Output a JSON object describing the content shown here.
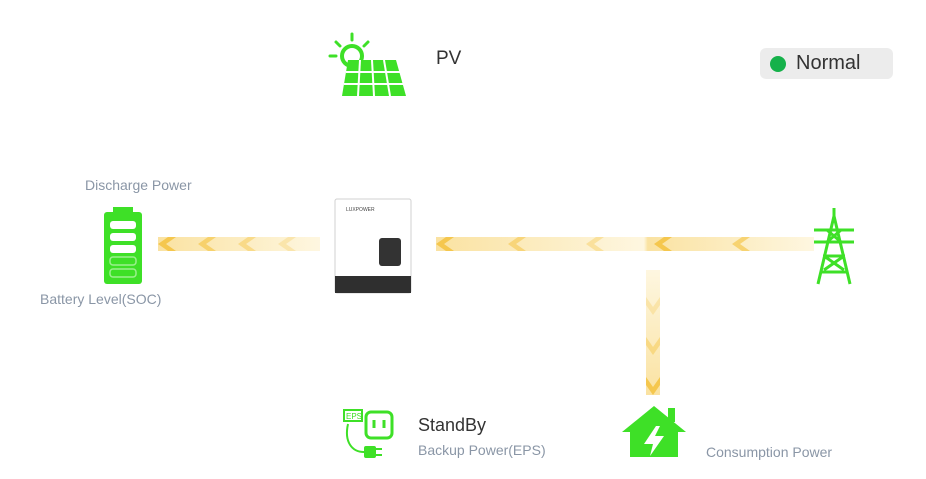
{
  "status": {
    "label": "Normal",
    "color": "#15b14a"
  },
  "pv": {
    "label": "PV",
    "icon": "solar-panel-icon"
  },
  "battery": {
    "discharge_label": "Discharge Power",
    "soc_label": "Battery Level(SOC)",
    "icon": "battery-icon"
  },
  "inverter": {
    "brand": "LUXPOWER",
    "icon": "inverter-icon"
  },
  "grid": {
    "icon": "grid-tower-icon"
  },
  "eps": {
    "status": "StandBy",
    "label": "Backup Power(EPS)",
    "badge": "EPS",
    "icon": "eps-plug-icon"
  },
  "consumption": {
    "label": "Consumption Power",
    "icon": "house-icon"
  },
  "colors": {
    "green": "#3ee027",
    "flow": "#f9d77a",
    "text_muted": "#8a96a6"
  }
}
